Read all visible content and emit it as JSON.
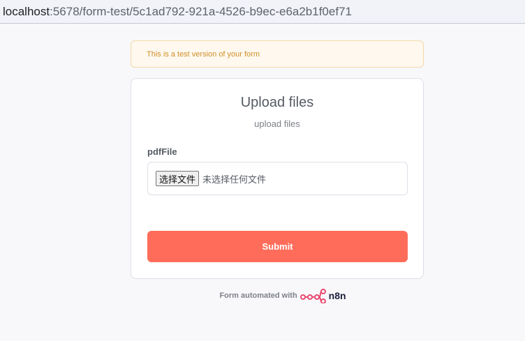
{
  "browser": {
    "url_host": "localhost",
    "url_rest": ":5678/form-test/5c1ad792-921a-4526-b9ec-e6a2b1f0ef71"
  },
  "banner": {
    "text": "This is a test version of your form"
  },
  "form": {
    "title": "Upload files",
    "subtitle": "upload files",
    "field_label": "pdfFile",
    "file_button_label": "选择文件",
    "file_status": "未选择任何文件",
    "submit_label": "Submit"
  },
  "footer": {
    "text": "Form automated with",
    "brand": "n8n",
    "brand_icon": "n8n-logo-icon"
  },
  "colors": {
    "accent": "#ff6d5a",
    "banner_text": "#d08f2a",
    "banner_bg": "#fef8ee",
    "brand_pink": "#ea4b71"
  }
}
